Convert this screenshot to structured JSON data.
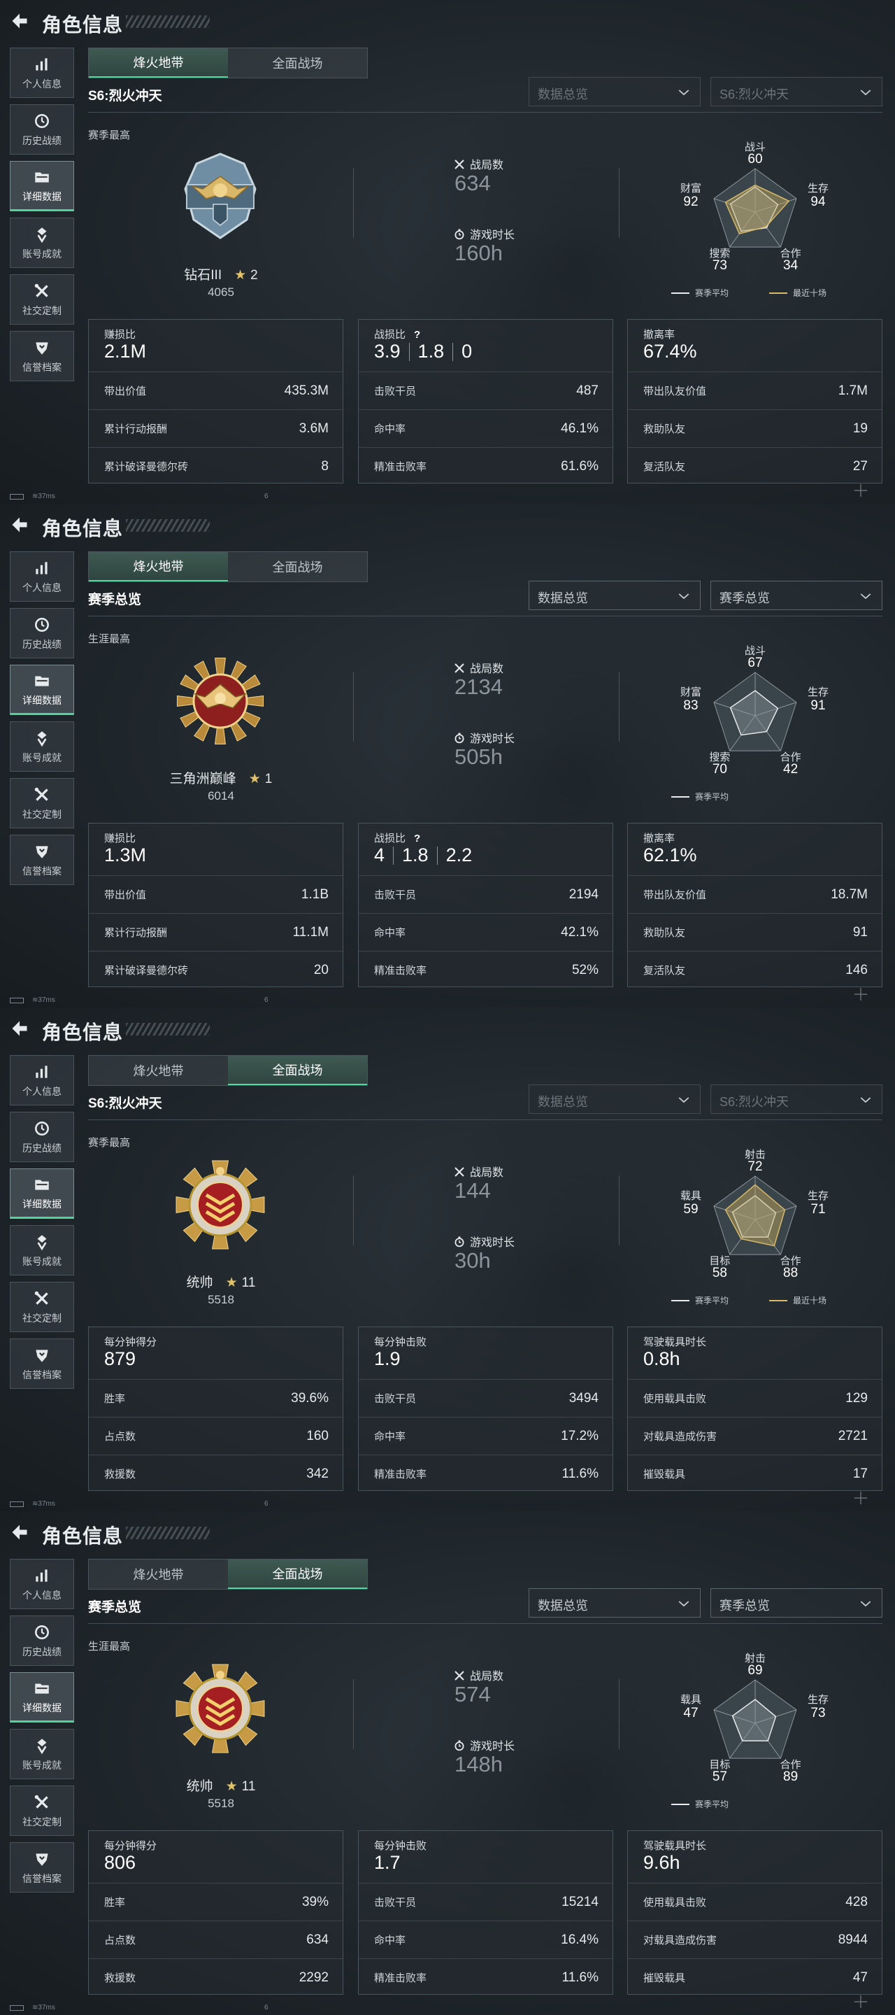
{
  "title": "角色信息",
  "sidebar": [
    {
      "label": "个人信息",
      "icon": "bar-chart-icon"
    },
    {
      "label": "历史战绩",
      "icon": "clock-icon"
    },
    {
      "label": "详细数据",
      "icon": "folder-icon"
    },
    {
      "label": "账号成就",
      "icon": "medal-icon"
    },
    {
      "label": "社交定制",
      "icon": "tools-icon"
    },
    {
      "label": "信誉档案",
      "icon": "shield-icon"
    }
  ],
  "sidebar_active": 2,
  "tabs": [
    "烽火地带",
    "全面战场"
  ],
  "status": {
    "ping": "37ms",
    "num": "6"
  },
  "legend_labels": {
    "avg": "赛季平均",
    "recent": "最近十场"
  },
  "stat_labels": {
    "battles": "战局数",
    "time": "游戏时长"
  },
  "screens": [
    {
      "active_tab": 0,
      "subtitle": "S6:烈火冲天",
      "dropdown1": "数据总览",
      "dropdown2": "S6:烈火冲天",
      "dropdowns_dim": true,
      "best_label": "赛季最高",
      "emblem": "diamond-eagle",
      "rank_name": "钻石III",
      "rank_stars": "2",
      "rank_score": "4065",
      "battles": "634",
      "play_time": "160h",
      "radar": {
        "axes": [
          "战斗",
          "生存",
          "合作",
          "搜索",
          "财富"
        ],
        "values": [
          "60",
          "94",
          "34",
          "73",
          "92"
        ],
        "avg": [
          0.58,
          0.55,
          0.45,
          0.55,
          0.6
        ],
        "recent": [
          0.62,
          0.82,
          0.42,
          0.62,
          0.72
        ],
        "show_recent": true
      },
      "panels": [
        {
          "title": "赚损比",
          "big": [
            "2.1M"
          ],
          "rows": [
            [
              "带出价值",
              "435.3M"
            ],
            [
              "累计行动报酬",
              "3.6M"
            ],
            [
              "累计破译曼德尔砖",
              "8"
            ]
          ]
        },
        {
          "title": "战损比",
          "help": "?",
          "big": [
            "3.9",
            "1.8",
            "0"
          ],
          "rows": [
            [
              "击败干员",
              "487"
            ],
            [
              "命中率",
              "46.1%"
            ],
            [
              "精准击败率",
              "61.6%"
            ]
          ]
        },
        {
          "title": "撤离率",
          "big": [
            "67.4%"
          ],
          "rows": [
            [
              "带出队友价值",
              "1.7M"
            ],
            [
              "救助队友",
              "19"
            ],
            [
              "复活队友",
              "27"
            ]
          ]
        }
      ]
    },
    {
      "active_tab": 0,
      "subtitle": "赛季总览",
      "dropdown1": "数据总览",
      "dropdown2": "赛季总览",
      "dropdowns_dim": false,
      "best_label": "生涯最高",
      "emblem": "peak-eagle",
      "rank_name": "三角洲巅峰",
      "rank_stars": "1",
      "rank_score": "6014",
      "battles": "2134",
      "play_time": "505h",
      "radar": {
        "axes": [
          "战斗",
          "生存",
          "合作",
          "搜索",
          "财富"
        ],
        "values": [
          "67",
          "91",
          "42",
          "70",
          "83"
        ],
        "avg": [
          0.58,
          0.55,
          0.45,
          0.55,
          0.6
        ],
        "recent": [],
        "show_recent": false
      },
      "panels": [
        {
          "title": "赚损比",
          "big": [
            "1.3M"
          ],
          "rows": [
            [
              "带出价值",
              "1.1B"
            ],
            [
              "累计行动报酬",
              "11.1M"
            ],
            [
              "累计破译曼德尔砖",
              "20"
            ]
          ]
        },
        {
          "title": "战损比",
          "help": "?",
          "big": [
            "4",
            "1.8",
            "2.2"
          ],
          "rows": [
            [
              "击败干员",
              "2194"
            ],
            [
              "命中率",
              "42.1%"
            ],
            [
              "精准击败率",
              "52%"
            ]
          ]
        },
        {
          "title": "撤离率",
          "big": [
            "62.1%"
          ],
          "rows": [
            [
              "带出队友价值",
              "18.7M"
            ],
            [
              "救助队友",
              "91"
            ],
            [
              "复活队友",
              "146"
            ]
          ]
        }
      ]
    },
    {
      "active_tab": 1,
      "subtitle": "S6:烈火冲天",
      "dropdown1": "数据总览",
      "dropdown2": "S6:烈火冲天",
      "dropdowns_dim": true,
      "best_label": "赛季最高",
      "emblem": "marshal",
      "rank_name": "统帅",
      "rank_stars": "11",
      "rank_score": "5518",
      "battles": "144",
      "play_time": "30h",
      "radar": {
        "axes": [
          "射击",
          "生存",
          "合作",
          "目标",
          "载具"
        ],
        "values": [
          "72",
          "71",
          "88",
          "58",
          "59"
        ],
        "avg": [
          0.55,
          0.5,
          0.5,
          0.5,
          0.55
        ],
        "recent": [
          0.8,
          0.72,
          0.75,
          0.55,
          0.72
        ],
        "show_recent": true
      },
      "panels": [
        {
          "title": "每分钟得分",
          "big": [
            "879"
          ],
          "rows": [
            [
              "胜率",
              "39.6%"
            ],
            [
              "占点数",
              "160"
            ],
            [
              "救援数",
              "342"
            ]
          ]
        },
        {
          "title": "每分钟击败",
          "big": [
            "1.9"
          ],
          "rows": [
            [
              "击败干员",
              "3494"
            ],
            [
              "命中率",
              "17.2%"
            ],
            [
              "精准击败率",
              "11.6%"
            ]
          ]
        },
        {
          "title": "驾驶载具时长",
          "big": [
            "0.8h"
          ],
          "rows": [
            [
              "使用载具击败",
              "129"
            ],
            [
              "对载具造成伤害",
              "2721"
            ],
            [
              "摧毁载具",
              "17"
            ]
          ]
        }
      ]
    },
    {
      "active_tab": 1,
      "subtitle": "赛季总览",
      "dropdown1": "数据总览",
      "dropdown2": "赛季总览",
      "dropdowns_dim": false,
      "best_label": "生涯最高",
      "emblem": "marshal",
      "rank_name": "统帅",
      "rank_stars": "11",
      "rank_score": "5518",
      "battles": "574",
      "play_time": "148h",
      "radar": {
        "axes": [
          "射击",
          "生存",
          "合作",
          "目标",
          "载具"
        ],
        "values": [
          "69",
          "73",
          "89",
          "57",
          "47"
        ],
        "avg": [
          0.55,
          0.5,
          0.5,
          0.5,
          0.55
        ],
        "recent": [],
        "show_recent": false
      },
      "panels": [
        {
          "title": "每分钟得分",
          "big": [
            "806"
          ],
          "rows": [
            [
              "胜率",
              "39%"
            ],
            [
              "占点数",
              "634"
            ],
            [
              "救援数",
              "2292"
            ]
          ]
        },
        {
          "title": "每分钟击败",
          "big": [
            "1.7"
          ],
          "rows": [
            [
              "击败干员",
              "15214"
            ],
            [
              "命中率",
              "16.4%"
            ],
            [
              "精准击败率",
              "11.6%"
            ]
          ]
        },
        {
          "title": "驾驶载具时长",
          "big": [
            "9.6h"
          ],
          "rows": [
            [
              "使用载具击败",
              "428"
            ],
            [
              "对载具造成伤害",
              "8944"
            ],
            [
              "摧毁载具",
              "47"
            ]
          ]
        }
      ]
    }
  ]
}
